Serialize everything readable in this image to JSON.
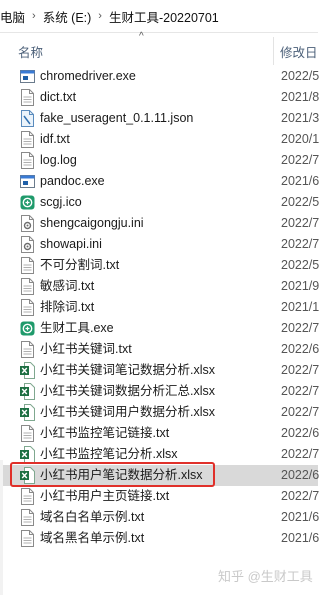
{
  "address_bar": {
    "crumbs": [
      "电脑",
      "系统 (E:)",
      "生财工具-20220701"
    ],
    "separator": "›"
  },
  "columns": {
    "name": "名称",
    "date": "修改日"
  },
  "files": [
    {
      "name": "chromedriver.exe",
      "date": "2022/5",
      "icon": "exe-icon"
    },
    {
      "name": "dict.txt",
      "date": "2021/8",
      "icon": "txt-icon"
    },
    {
      "name": "fake_useragent_0.1.11.json",
      "date": "2021/3",
      "icon": "json-icon"
    },
    {
      "name": "idf.txt",
      "date": "2020/1",
      "icon": "txt-icon"
    },
    {
      "name": "log.log",
      "date": "2022/7",
      "icon": "txt-icon"
    },
    {
      "name": "pandoc.exe",
      "date": "2021/6",
      "icon": "exe-icon"
    },
    {
      "name": "scgj.ico",
      "date": "2022/5",
      "icon": "app-icon"
    },
    {
      "name": "shengcaigongju.ini",
      "date": "2022/7",
      "icon": "ini-icon"
    },
    {
      "name": "showapi.ini",
      "date": "2022/7",
      "icon": "ini-icon"
    },
    {
      "name": "不可分割词.txt",
      "date": "2022/5",
      "icon": "txt-icon"
    },
    {
      "name": "敏感词.txt",
      "date": "2021/9",
      "icon": "txt-icon"
    },
    {
      "name": "排除词.txt",
      "date": "2021/1",
      "icon": "txt-icon"
    },
    {
      "name": "生财工具.exe",
      "date": "2022/7",
      "icon": "app-icon"
    },
    {
      "name": "小红书关键词.txt",
      "date": "2022/6",
      "icon": "txt-icon"
    },
    {
      "name": "小红书关键词笔记数据分析.xlsx",
      "date": "2022/7",
      "icon": "excel-icon"
    },
    {
      "name": "小红书关键词数据分析汇总.xlsx",
      "date": "2022/7",
      "icon": "excel-icon"
    },
    {
      "name": "小红书关键词用户数据分析.xlsx",
      "date": "2022/7",
      "icon": "excel-icon"
    },
    {
      "name": "小红书监控笔记链接.txt",
      "date": "2022/6",
      "icon": "txt-icon"
    },
    {
      "name": "小红书监控笔记分析.xlsx",
      "date": "2022/7",
      "icon": "excel-icon"
    },
    {
      "name": "小红书用户笔记数据分析.xlsx",
      "date": "2022/6",
      "icon": "excel-icon",
      "selected": true
    },
    {
      "name": "小红书用户主页链接.txt",
      "date": "2022/7",
      "icon": "txt-icon"
    },
    {
      "name": "域名白名单示例.txt",
      "date": "2021/6",
      "icon": "txt-icon"
    },
    {
      "name": "域名黑名单示例.txt",
      "date": "2021/6",
      "icon": "txt-icon"
    }
  ],
  "watermark": "知乎 @生财工具",
  "colors": {
    "selection_outline": "#e0302a",
    "excel_green": "#1d6f42",
    "app_green": "#1f9a6b"
  }
}
